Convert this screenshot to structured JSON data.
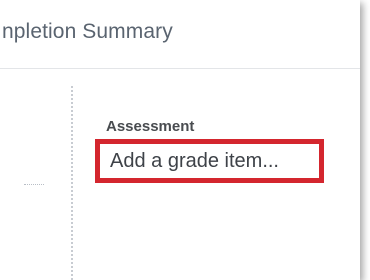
{
  "header": {
    "title": "npletion Summary"
  },
  "assessment": {
    "label": "Assessment",
    "add_grade_item_link": "Add a grade item..."
  },
  "colors": {
    "highlight_border": "#d4262e",
    "title_text": "#5a6470"
  }
}
